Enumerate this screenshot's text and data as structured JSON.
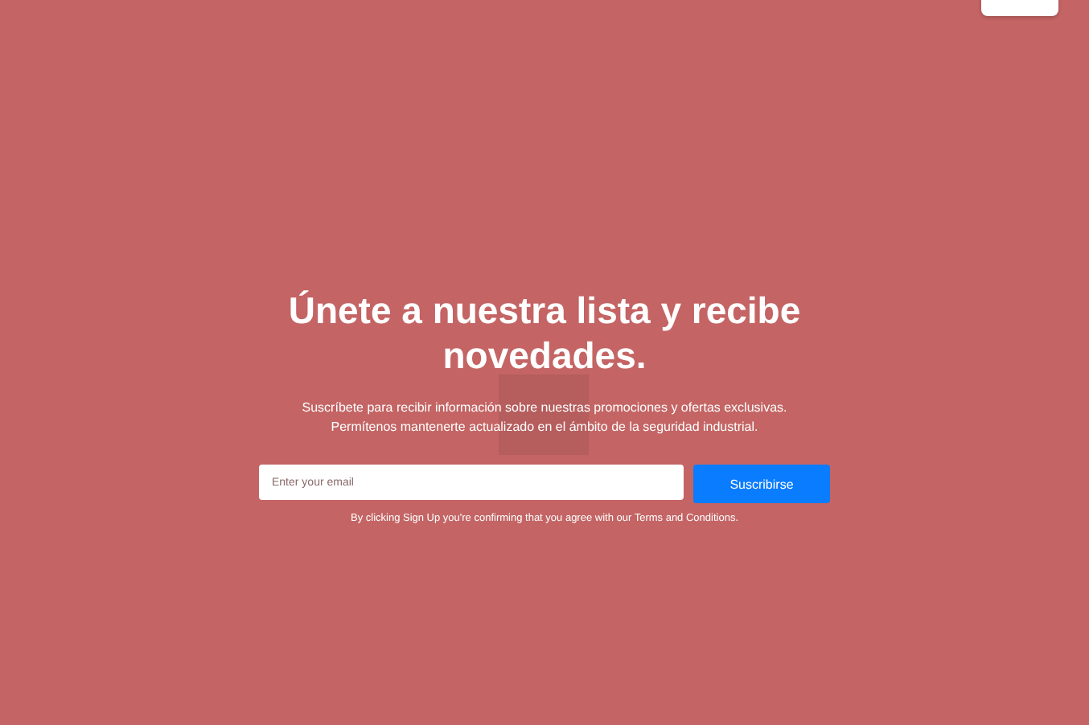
{
  "title": "Únete a nuestra lista y recibe novedades.",
  "description": "Suscríbete para recibir información sobre nuestras promociones y ofertas exclusivas. Permítenos mantenerte actualizado en el ámbito de la seguridad industrial.",
  "email_field": {
    "placeholder": "Enter your email"
  },
  "subscribe_button": "Suscribirse",
  "disclaimer": "By clicking Sign Up you're confirming that you agree with our Terms and Conditions."
}
